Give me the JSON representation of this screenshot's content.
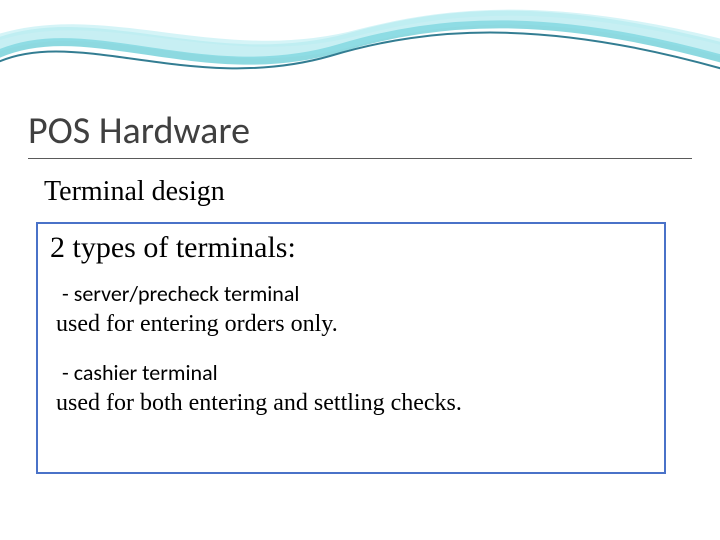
{
  "slide": {
    "title": "POS Hardware",
    "subheading": "Terminal design",
    "box": {
      "heading": "2 types of terminals:",
      "items": [
        {
          "label": "- server/precheck terminal",
          "desc": "used for entering orders only."
        },
        {
          "label": "- cashier terminal",
          "desc": "used for both entering and settling checks."
        }
      ]
    }
  }
}
